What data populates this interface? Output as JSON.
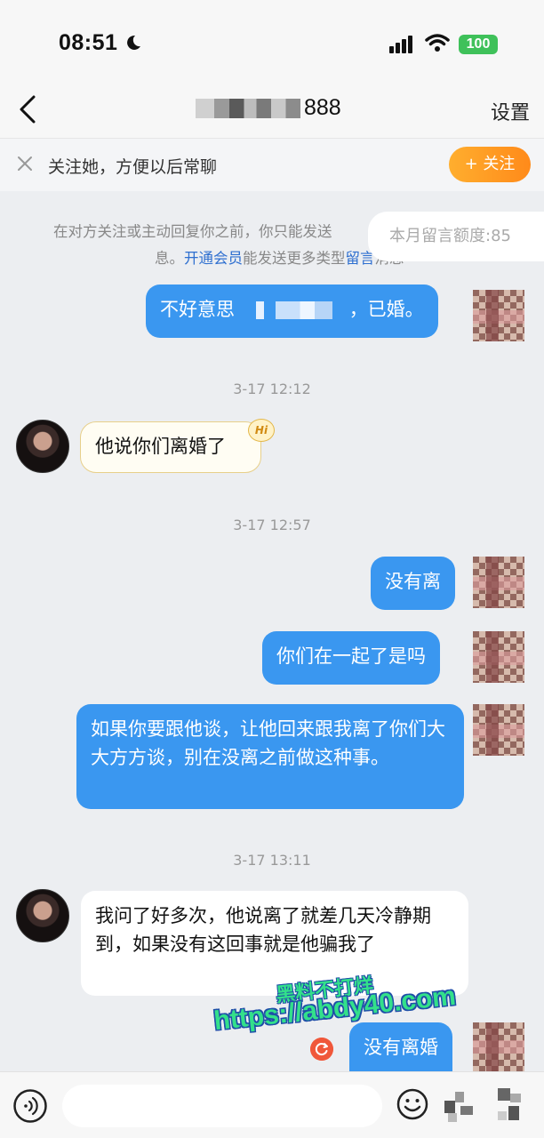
{
  "status_bar": {
    "time": "08:51",
    "battery": "100"
  },
  "nav": {
    "title_suffix": "888",
    "settings_label": "设置"
  },
  "follow_bar": {
    "text": "关注她，方便以后常聊",
    "button_label": "+ 关注"
  },
  "notice": {
    "line1": "在对方关注或主动回复你之前，你只能发送",
    "line2_a": "息。",
    "line2_link1": "开通会员",
    "line2_b": "能发送更多类型",
    "line2_link2": "留言",
    "line2_c": "消息"
  },
  "quota": "本月留言额度:85",
  "messages": {
    "m1_a": "不好意思",
    "m1_b": "，已婚。",
    "t1": "3-17 12:12",
    "m2": "他说你们离婚了",
    "hi": "Hi",
    "t2": "3-17 12:57",
    "m3": "没有离",
    "m4": "你们在一起了是吗",
    "m5": "如果你要跟他谈，让他回来跟我离了你们大大方方谈，别在没离之前做这种事。",
    "t3": "3-17 13:11",
    "m6": "我问了好多次，他说离了就差几天冷静期到，如果没有这回事就是他骗我了",
    "m7": "没有离婚"
  },
  "watermark": {
    "line1": "黑料不打烊",
    "line2": "https://abdy40.com"
  },
  "input": {
    "placeholder": ""
  },
  "colors": {
    "accent_blue": "#3a97f0",
    "follow_orange": "#ff9a22"
  }
}
